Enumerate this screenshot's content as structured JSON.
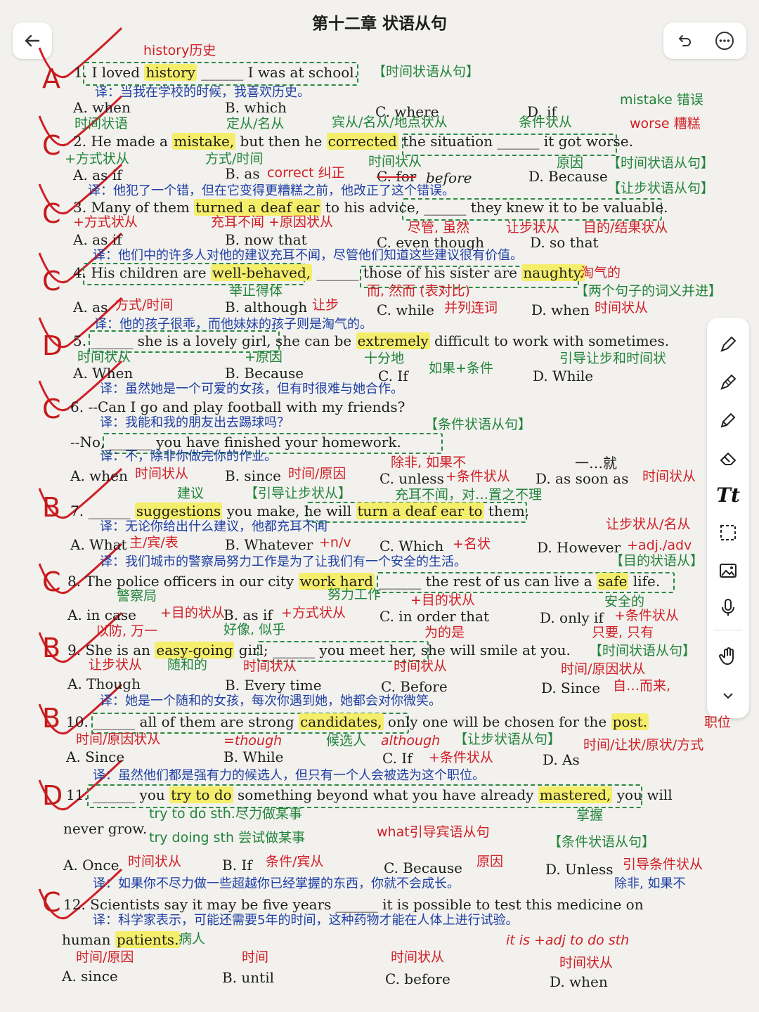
{
  "chapter_title": "第十二章  状语从句",
  "grades": [
    "A",
    "C",
    "C",
    "C",
    "D",
    "C",
    "B",
    "C",
    "B",
    "B",
    "D",
    "C"
  ],
  "q1": {
    "num": "1. I loved ",
    "w1": "history",
    "rest": " ______ I was at school.",
    "tag": "【时间状语从句】",
    "note": "history历史",
    "trans": "译：当我在学校的时候，我喜欢历史。",
    "a": "A. when",
    "b": "B. which",
    "c": "C. where",
    "d": "D. if",
    "la": "时间状语",
    "lb": "定从/名从",
    "lc": "宾从/名从/地点状从",
    "ld": "条件状从"
  },
  "q2": {
    "num": "2. He made a ",
    "w1": "mistake,",
    "mid": " but then he ",
    "w2": "corrected",
    "rest": " the situation ______ it got worse.",
    "n1": "mistake 错误",
    "n2": "worse 糟糕",
    "n3": "+方式状从",
    "n4": "方式/时间",
    "n5": "时间状从",
    "n6": "correct 纠正",
    "n7": "before",
    "n8": "原因",
    "tag": "【时间状语从句】",
    "trans": "译：他犯了一个错，但在它变得更糟糕之前，他改正了这个错误。",
    "a": "A. as if",
    "b": "B. as",
    "c": "C. for",
    "d": "D. Because"
  },
  "q3": {
    "num": "3. Many of them ",
    "w1": "turned a deaf ear",
    "rest": " to his advice, ______ they knew it to be valuable.",
    "tag": "【让步状语从句】",
    "n1": "+方式状从",
    "n2": "充耳不闻 +原因状从",
    "n3": "尽管, 虽然",
    "n4": "让步状从",
    "n5": "目的/结果状从",
    "trans": "译：他们中的许多人对他的建议充耳不闻，尽管他们知道这些建议很有价值。",
    "a": "A. as if",
    "b": "B. now that",
    "c": "C. even though",
    "d": "D. so that"
  },
  "q4": {
    "num": "4. His children are ",
    "w1": "well-behaved,",
    "rest": " ______ those of his sister are ",
    "w2": "naughty.",
    "n1": "淘气的",
    "n2": "举止得体",
    "n3": "而, 然而 (表对比)",
    "tag": "【两个句子的词义并进】",
    "a": "A. as",
    "la": "方式/时间",
    "b": "B. although",
    "lb": "让步",
    "c": "C. while",
    "lc": "并列连词",
    "d": "D. when",
    "ld": "时间状从",
    "trans": "译：他的孩子很乖，而他妹妹的孩子则是淘气的。"
  },
  "q5": {
    "num": "5. ______ she is a lovely girl, she can be ",
    "w1": "extremely",
    "rest": " difficult to work with sometimes.",
    "n1": "时间状从",
    "n2": "+原因",
    "n3": "十分地",
    "n4": "如果+条件",
    "n5": "引导让步和时间状",
    "a": "A. When",
    "b": "B. Because",
    "c": "C. If",
    "d": "D. While",
    "trans": "译：虽然她是一个可爱的女孩，但有时很难与她合作。"
  },
  "q6": {
    "line1": "6. --Can I go and play football with my friends?",
    "trans1": "译：我能和我的朋友出去踢球吗？",
    "tag": "【条件状语从句】",
    "line2": "--No, ______ you have finished your homework.",
    "trans2": "译：不，除非你做完你的作业。",
    "a": "A. when",
    "la": "时间状从",
    "b": "B. since",
    "lb": "时间/原因",
    "c": "C. unless",
    "lc": "+条件状从",
    "d": "D. as soon as",
    "ld": "时间状从",
    "n1": "除非, 如果不",
    "n2": "一…就"
  },
  "q7": {
    "num": "7. ______ ",
    "w1": "suggestions",
    "mid": " you make, he will ",
    "w2": "turn a deaf ear to",
    "rest": " them.",
    "n1": "建议",
    "tag": "【引导让步状从】",
    "n2": "充耳不闻，对…置之不理",
    "trans": "译：无论你给出什么建议，他都充耳不闻",
    "a": "A. What",
    "la": "主/宾/表",
    "b": "B. Whatever",
    "lb": "+n/v",
    "c": "C. Which",
    "lc": "+名状",
    "d": "D. However",
    "ld": "+adj./adv",
    "n3": "让步状从/名从"
  },
  "q8": {
    "trans0": "译：我们城市的警察局努力工作是为了让我们有一个安全的生活。",
    "tag": "【目的状语从】",
    "num": "8. The police officers in our city ",
    "w1": "work hard",
    "rest": " ______ the rest of us can live a ",
    "w2": "safe",
    "rest2": " life.",
    "n1": "警察局",
    "n2": "努力工作",
    "n3": "+目的状从",
    "n4": "安全的",
    "a": "A. in case",
    "la": "+目的状从",
    "b": "B. as if",
    "lb": "+方式状从",
    "c": "C. in order that",
    "d": "D. only if",
    "ld": "+条件状从",
    "n5": "以防, 万一",
    "n6": "好像, 似乎",
    "n7": "为的是",
    "n8": "只要, 只有"
  },
  "q9": {
    "num": "9. She is an ",
    "w1": "easy-going",
    "rest": " girl; ______ you meet her, she will smile at you.",
    "tag": "【时间状语从句】",
    "n1": "让步状从",
    "n2": "随和的",
    "n3": "时间状从",
    "n4": "时间状从",
    "n5": "时间/原因状从",
    "a": "A. Though",
    "b": "B. Every time",
    "c": "C. Before",
    "d": "D. Since",
    "n6": "自…而来,",
    "trans": "译：她是一个随和的女孩，每次你遇到她，她都会对你微笑。"
  },
  "q10": {
    "num": "10. ______ all of them are strong ",
    "w1": "candidates,",
    "mid": " only one will be chosen for the ",
    "w2": "post.",
    "n0": "职位",
    "n1": "时间/原因状从",
    "n2": "=though",
    "n3": "候选人",
    "n4": "although",
    "tag": "【让步状语从句】",
    "n5": "时间/让状/原状/方式",
    "a": "A. Since",
    "b": "B. While",
    "c": "C. If",
    "lc": "+条件状从",
    "d": "D. As",
    "trans": "译：虽然他们都是强有力的候选人，但只有一个人会被选为这个职位。"
  },
  "q11": {
    "num": "11. ______ you ",
    "w1": "try to do",
    "mid": " something beyond what you have already ",
    "w2": "mastered,",
    "rest": " you will",
    "line2": "never grow.",
    "n1": "try to do sth.尽力做某事",
    "n2": "try doing sth 尝试做某事",
    "n3": "what引导宾语从句",
    "n4": "掌握",
    "tag": "【条件状语从句】",
    "a": "A. Once",
    "la": "时间状从",
    "b": "B. If",
    "lb": "条件/宾从",
    "c": "C. Because",
    "lc": "原因",
    "d": "D. Unless",
    "ld": "引导条件状从",
    "trans": "译：如果你不尽力做一些超越你已经掌握的东西，你就不会成长。",
    "n5": "除非, 如果不"
  },
  "q12": {
    "line1": "12. Scientists say it may be five years ______ it is possible to test this medicine on",
    "trans": "译：科学家表示，可能还需要5年的时间，这种药物才能在人体上进行试验。",
    "line2a": "human ",
    "w1": "patients.",
    "n1": "病人",
    "n2": "it is +adj to do sth",
    "la": "时间/原因",
    "lb": "时间",
    "lc": "时间状从",
    "ld": "时间状从",
    "a": "A. since",
    "b": "B. until",
    "c": "C. before",
    "d": "D. when"
  },
  "icons": {
    "back": "back-arrow-icon",
    "undo": "undo-icon",
    "more": "more-options-icon"
  },
  "colors": {
    "red": "#d01f25",
    "green": "#23843a",
    "blue": "#1e3fa3",
    "highlight": "#f5ee6a"
  }
}
